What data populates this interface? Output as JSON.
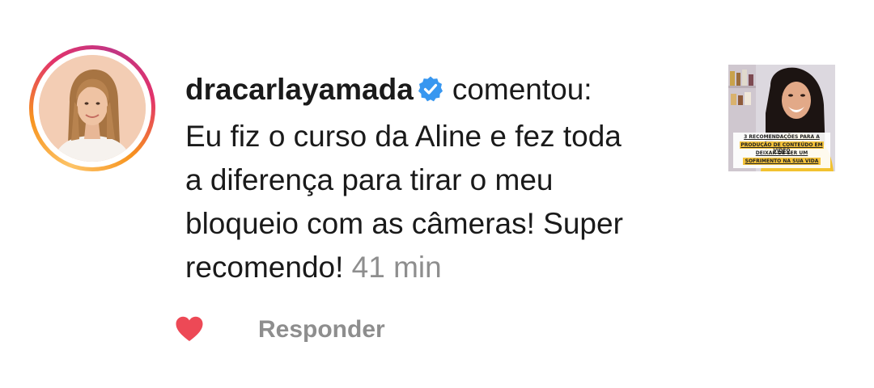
{
  "comment": {
    "username": "dracarlayamada",
    "verified": true,
    "action_text": "comentou:",
    "text_lines": [
      "Eu fiz o curso da Aline e fez toda",
      "a diferença para tirar o meu",
      "bloqueio com as câmeras! Super",
      "recomendo!"
    ],
    "timestamp": "41 min"
  },
  "thumbnail": {
    "caption_lines": [
      "3 RECOMENDAÇÕES PARA A",
      "PRODUÇÃO DE CONTEÚDO EM VÍDEO",
      "DEIXAR DE SER UM",
      "SOFRIMENTO NA SUA VIDA"
    ]
  },
  "actions": {
    "like_icon": "heart-icon",
    "liked": true,
    "reply_label": "Responder"
  },
  "colors": {
    "text": "#1a1a1a",
    "muted": "#8e8e8e",
    "verified_badge": "#3897f0",
    "heart": "#ed4956"
  }
}
